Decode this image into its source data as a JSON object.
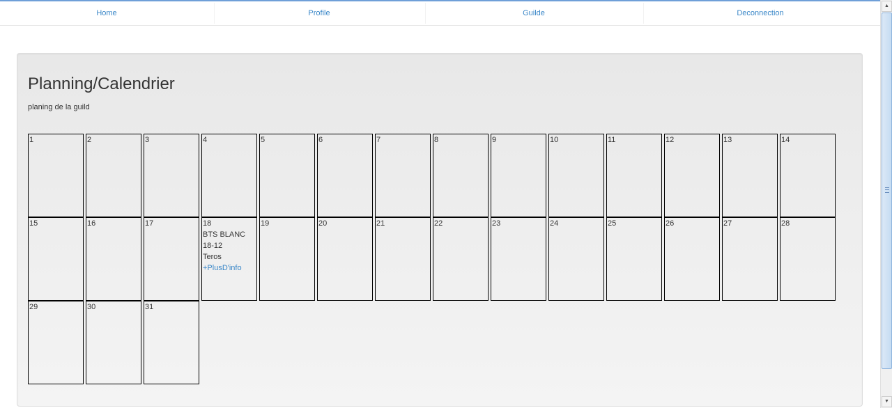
{
  "nav": {
    "items": [
      {
        "label": "Home"
      },
      {
        "label": "Profile"
      },
      {
        "label": "Guilde"
      },
      {
        "label": "Deconnection"
      }
    ]
  },
  "main": {
    "title": "Planning/Calendrier",
    "subtitle": "planing de la guild"
  },
  "calendar": {
    "days": [
      {
        "day": "1"
      },
      {
        "day": "2"
      },
      {
        "day": "3"
      },
      {
        "day": "4"
      },
      {
        "day": "5"
      },
      {
        "day": "6"
      },
      {
        "day": "7"
      },
      {
        "day": "8"
      },
      {
        "day": "9"
      },
      {
        "day": "10"
      },
      {
        "day": "11"
      },
      {
        "day": "12"
      },
      {
        "day": "13"
      },
      {
        "day": "14"
      },
      {
        "day": "15"
      },
      {
        "day": "16"
      },
      {
        "day": "17"
      },
      {
        "day": "18",
        "event": {
          "title": "BTS BLANC",
          "date": "18-12",
          "author": "Teros",
          "more": "+PlusD'info"
        }
      },
      {
        "day": "19"
      },
      {
        "day": "20"
      },
      {
        "day": "21"
      },
      {
        "day": "22"
      },
      {
        "day": "23"
      },
      {
        "day": "24"
      },
      {
        "day": "25"
      },
      {
        "day": "26"
      },
      {
        "day": "27"
      },
      {
        "day": "28"
      },
      {
        "day": "29"
      },
      {
        "day": "30"
      },
      {
        "day": "31"
      }
    ]
  },
  "colors": {
    "link": "#3a87c8",
    "hero_background": "#ececec",
    "cell_border": "#000000"
  }
}
